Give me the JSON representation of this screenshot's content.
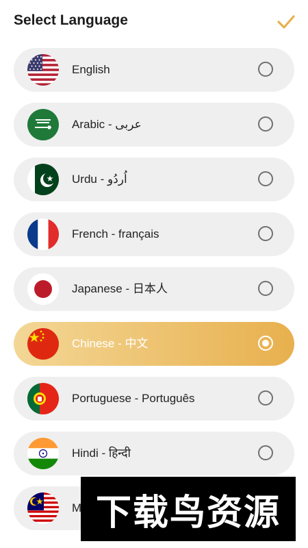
{
  "header": {
    "title": "Select Language"
  },
  "languages": [
    {
      "label": "English",
      "flag": "us-flag-icon",
      "selected": false
    },
    {
      "label": "Arabic - عربى",
      "flag": "saudi-flag-icon",
      "selected": false
    },
    {
      "label": "Urdu - اُردُو",
      "flag": "pakistan-flag-icon",
      "selected": false
    },
    {
      "label": "French - français",
      "flag": "france-flag-icon",
      "selected": false
    },
    {
      "label": "Japanese - 日本人",
      "flag": "japan-flag-icon",
      "selected": false
    },
    {
      "label": "Chinese - 中文",
      "flag": "china-flag-icon",
      "selected": true
    },
    {
      "label": "Portuguese - Português",
      "flag": "portugal-flag-icon",
      "selected": false
    },
    {
      "label": "Hindi - हिन्दी",
      "flag": "india-flag-icon",
      "selected": false
    },
    {
      "label": "M",
      "flag": "malaysia-flag-icon",
      "selected": false
    }
  ],
  "watermark": {
    "text": "下载鸟资源"
  },
  "colors": {
    "accent": "#e8b04e",
    "accent_light": "#f3d796",
    "item_bg": "#efefef",
    "radio_border": "#707070"
  }
}
